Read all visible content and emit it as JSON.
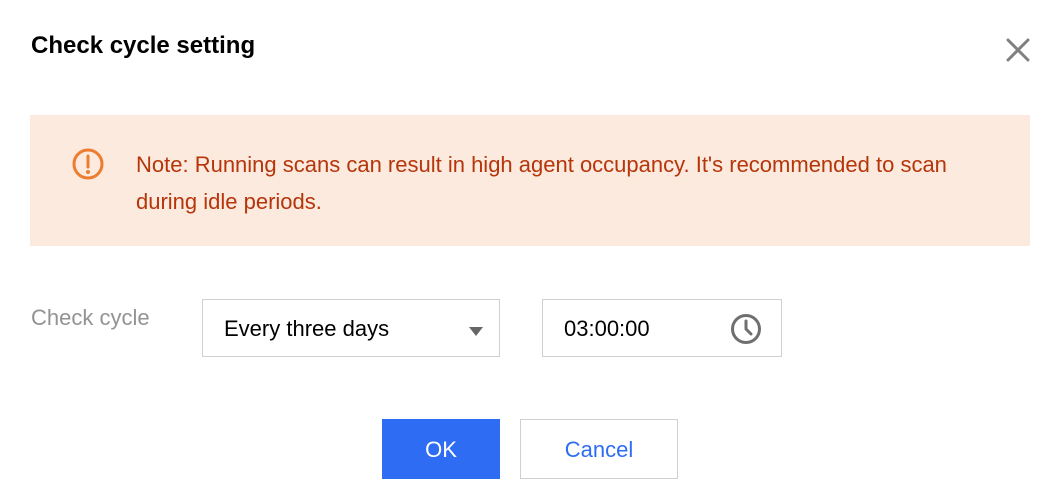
{
  "dialog": {
    "title": "Check cycle setting",
    "close_icon": "close-icon"
  },
  "notice": {
    "icon": "warning-circle-icon",
    "text": "Note: Running scans can result in high agent occupancy. It's recommended to scan during idle periods."
  },
  "form": {
    "check_cycle_label": "Check cycle",
    "cycle_select": {
      "selected": "Every three days",
      "icon": "caret-down-icon"
    },
    "time_input": {
      "value": "03:00:00",
      "icon": "clock-icon"
    }
  },
  "footer": {
    "ok_label": "OK",
    "cancel_label": "Cancel"
  },
  "colors": {
    "primary": "#2f6cf4",
    "notice_background": "#fbeadd",
    "notice_text": "#b6350b",
    "notice_icon": "#ec7d31",
    "label_text": "#939393",
    "border": "#d0d0d0"
  }
}
